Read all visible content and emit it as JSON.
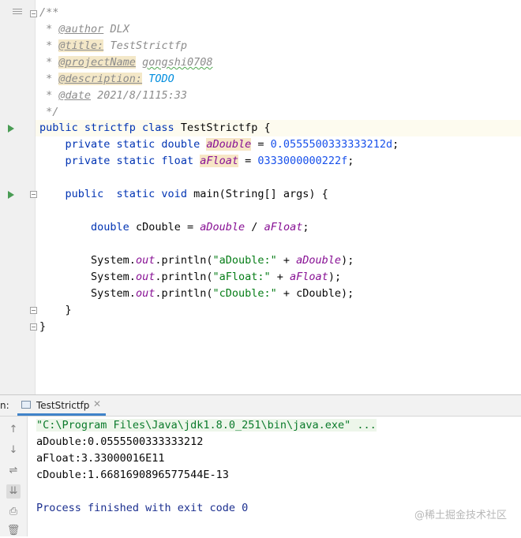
{
  "editor": {
    "doc": {
      "open": "/**",
      "author_tag": "@author",
      "author_value": "DLX",
      "title_tag": "@title:",
      "title_value": "TestStrictfp",
      "project_tag": "@projectName",
      "project_value": "gongshi0708",
      "description_tag": "@description:",
      "description_value": "TODO",
      "date_tag": "@date",
      "date_value": "2021/8/1115:33",
      "close": "*/"
    },
    "code": {
      "class_kw": "public strictfp class",
      "class_name": "TestStrictfp {",
      "field1_kw": "private static double",
      "field1_name": "aDouble",
      "field1_eq": "=",
      "field1_val": "0.0555500333333212d",
      "field2_kw": "private static float",
      "field2_name": "aFloat",
      "field2_eq": "=",
      "field2_val": "0333000000222f",
      "main_kw": "public  static void",
      "main_sig": "main(String[] args) {",
      "local_kw": "double",
      "local_expr": "cDouble =",
      "local_a": "aDouble",
      "local_div": "/",
      "local_b": "aFloat",
      "local_end": ";",
      "print_prefix": "System.",
      "print_out": "out",
      "print_method": ".println(",
      "print1_str": "\"aDouble:\"",
      "print1_plus": " + ",
      "print1_var": "aDouble",
      "print2_str": "\"aFloat:\"",
      "print2_plus": " + ",
      "print2_var": "aFloat",
      "print3_str": "\"cDouble:\"",
      "print3_rest": " + cDouble);",
      "close_paren": ");",
      "method_close": "}",
      "class_close": "}"
    }
  },
  "run_panel": {
    "prefix": "n:",
    "tab_label": "TestStrictfp",
    "tab_close": "✕",
    "output": {
      "cmd": "\"C:\\Program Files\\Java\\jdk1.8.0_251\\bin\\java.exe\" ...",
      "line1": "aDouble:0.0555500333333212",
      "line2": "aFloat:3.33000016E11",
      "line3": "cDouble:1.6681690896577544E-13",
      "finished": "Process finished with exit code 0"
    },
    "tools": [
      "↑",
      "↓",
      "⇌",
      "⇊",
      "⎙",
      "🗑"
    ]
  },
  "watermark": "@稀土掘金技术社区",
  "colors": {
    "keyword": "#0033b3",
    "field": "#871094",
    "number": "#1750eb",
    "string": "#067d17",
    "comment": "#8c8c8c",
    "run_green": "#499c54"
  }
}
